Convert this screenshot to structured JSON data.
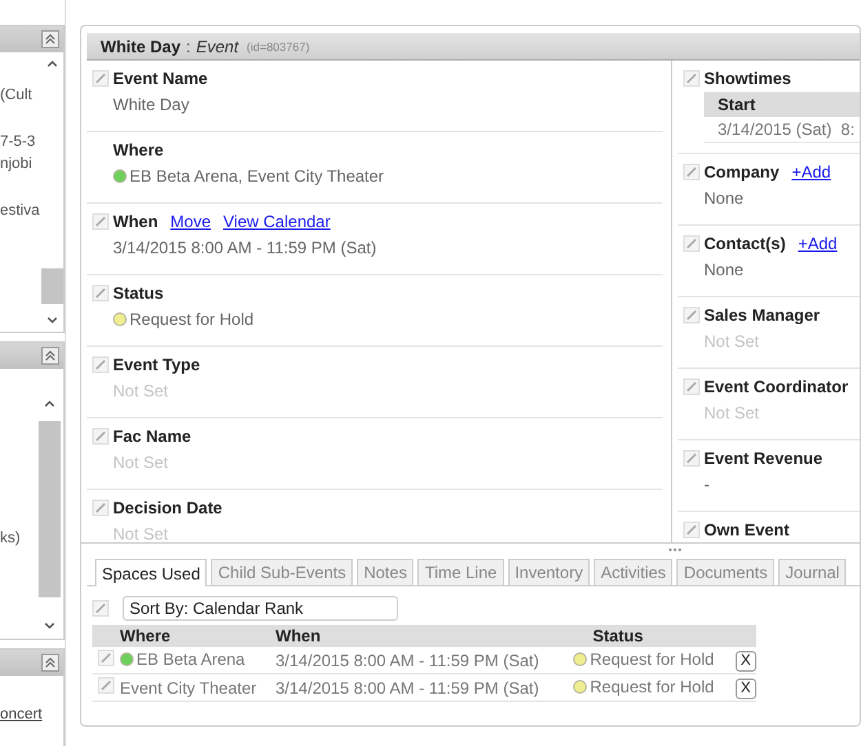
{
  "sidebar": {
    "panels": [
      {
        "items": [
          {
            "text": "(Cult",
            "kind": "text"
          },
          {
            "text": "7-5-3",
            "kind": "text"
          },
          {
            "text": "njobi",
            "kind": "text"
          },
          {
            "text": "estiva",
            "kind": "text"
          }
        ]
      },
      {
        "items": [
          {
            "text": "ks)",
            "kind": "text"
          }
        ]
      },
      {
        "items": [
          {
            "text": "oncert",
            "kind": "link"
          }
        ]
      }
    ]
  },
  "event": {
    "title": "White Day",
    "separator": ":",
    "type": "Event",
    "id": "(id=803767)"
  },
  "fields": [
    {
      "label": "Event Name",
      "editable": true,
      "value": "White Day",
      "muted": false
    },
    {
      "label": "Where",
      "editable": false,
      "value": "EB Beta Arena, Event City Theater",
      "muted": false,
      "color": "#6cd05a"
    },
    {
      "label": "When",
      "editable": true,
      "links": [
        "Move",
        "View Calendar"
      ],
      "value": "3/14/2015 8:00 AM - 11:59 PM (Sat)",
      "muted": false
    },
    {
      "label": "Status",
      "editable": true,
      "value": "Request for Hold",
      "muted": false,
      "color": "#f0ee90"
    },
    {
      "label": "Event Type",
      "editable": true,
      "value": "Not Set",
      "muted": true
    },
    {
      "label": "Fac Name",
      "editable": true,
      "value": "Not Set",
      "muted": true
    },
    {
      "label": "Decision Date",
      "editable": true,
      "value": "Not Set",
      "muted": true
    }
  ],
  "side_fields": [
    {
      "label": "Showtimes",
      "kind": "table",
      "column": "Start",
      "row": "3/14/2015 (Sat)  8:"
    },
    {
      "label": "Company",
      "kind": "field",
      "links": [
        "+Add"
      ],
      "value": "None",
      "muted": false
    },
    {
      "label": "Contact(s)",
      "kind": "field",
      "links": [
        "+Add"
      ],
      "value": "None",
      "muted": false
    },
    {
      "label": "Sales Manager",
      "kind": "field",
      "value": "Not Set",
      "muted": true
    },
    {
      "label": "Event Coordinator",
      "kind": "field",
      "value": "Not Set",
      "muted": true
    },
    {
      "label": "Event Revenue",
      "kind": "field",
      "value": "-",
      "muted": false
    },
    {
      "label": "Own Event",
      "kind": "field"
    }
  ],
  "tabs": [
    {
      "label": "Spaces Used",
      "selected": true
    },
    {
      "label": "Child Sub-Events",
      "selected": false
    },
    {
      "label": "Notes",
      "selected": false
    },
    {
      "label": "Time Line",
      "selected": false
    },
    {
      "label": "Inventory",
      "selected": false
    },
    {
      "label": "Activities",
      "selected": false
    },
    {
      "label": "Documents",
      "selected": false
    },
    {
      "label": "Journal",
      "selected": false
    }
  ],
  "sort": {
    "value": "Sort By: Calendar Rank"
  },
  "spaces": {
    "columns": [
      "Where",
      "When",
      "Status"
    ],
    "rows": [
      {
        "where": {
          "text": "EB Beta Arena",
          "color": "#6cd05a"
        },
        "when": "3/14/2015 8:00 AM - 11:59 PM (Sat)",
        "status": {
          "text": "Request for Hold",
          "color": "#f0ee90"
        },
        "remove": "X"
      },
      {
        "where": {
          "text": "Event City Theater"
        },
        "when": "3/14/2015 8:00 AM - 11:59 PM (Sat)",
        "status": {
          "text": "Request for Hold",
          "color": "#f0ee90"
        },
        "remove": "X"
      }
    ]
  }
}
